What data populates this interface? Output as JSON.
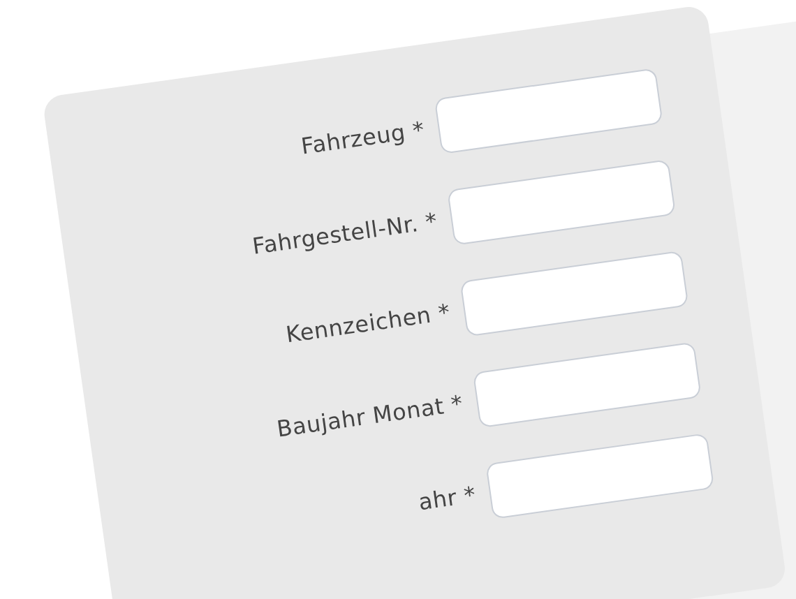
{
  "form": {
    "fields": [
      {
        "label": "Fahrzeug *"
      },
      {
        "label": "Fahrgestell-Nr. *"
      },
      {
        "label": "Kennzeichen *"
      },
      {
        "label": "Baujahr Monat *"
      },
      {
        "label": "ahr *"
      }
    ]
  }
}
